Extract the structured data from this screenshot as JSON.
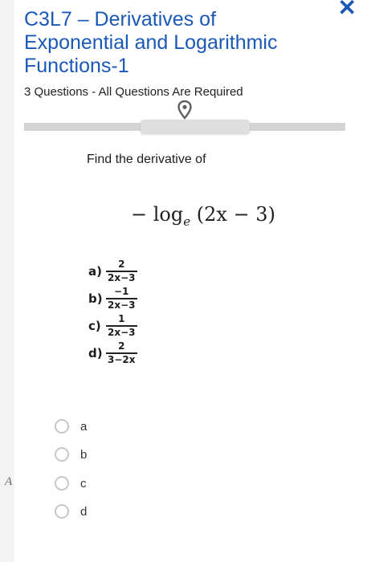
{
  "side_mark": "A",
  "header": {
    "title": "C3L7 – Derivatives of Exponential and Logarithmic Functions-1",
    "subtitle": "3 Questions - All Questions Are Required",
    "close_icon": "close-icon"
  },
  "progress": {
    "icon": "location-pin-icon"
  },
  "question": {
    "prompt": "Find the derivative of",
    "expression": {
      "prefix": "− log",
      "base": "e",
      "argument": "(2x − 3)"
    },
    "choices": [
      {
        "letter": "a)",
        "numerator": "2",
        "denominator": "2x−3"
      },
      {
        "letter": "b)",
        "numerator": "−1",
        "denominator": "2x−3"
      },
      {
        "letter": "c)",
        "numerator": "1",
        "denominator": "2x−3"
      },
      {
        "letter": "d)",
        "numerator": "2",
        "denominator": "3−2x"
      }
    ]
  },
  "answers": [
    {
      "label": "a"
    },
    {
      "label": "b"
    },
    {
      "label": "c"
    },
    {
      "label": "d"
    }
  ],
  "colors": {
    "accent": "#1a58b7",
    "radio_border": "#c7c7c7",
    "track": "#d4d4d4"
  }
}
